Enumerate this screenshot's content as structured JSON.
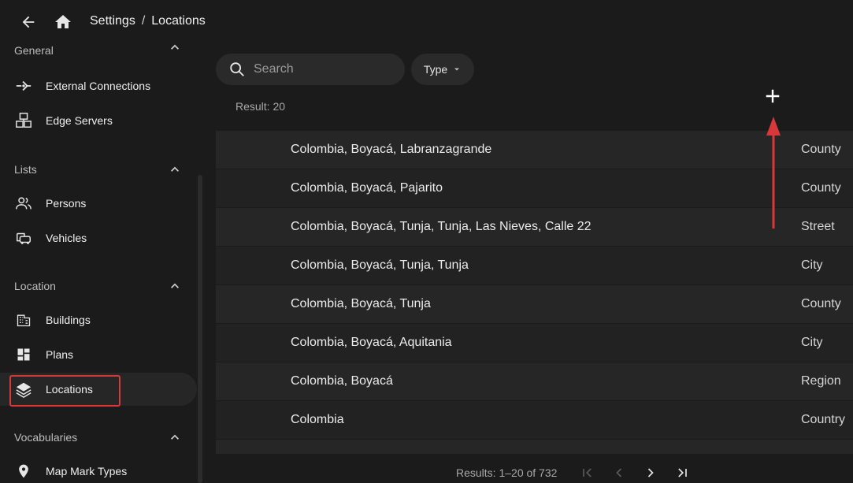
{
  "topbar": {
    "back_icon": "arrow-left-icon",
    "home_icon": "home-icon",
    "breadcrumb": [
      "Settings",
      "Locations"
    ],
    "separator": "/"
  },
  "sidebar": {
    "partial_header": "General",
    "items_top": [
      {
        "label": "External Connections",
        "icon": "connection-icon"
      },
      {
        "label": "Edge Servers",
        "icon": "servers-icon"
      }
    ],
    "sections": [
      {
        "title": "Lists",
        "items": [
          {
            "label": "Persons",
            "icon": "persons-icon"
          },
          {
            "label": "Vehicles",
            "icon": "vehicles-icon"
          }
        ]
      },
      {
        "title": "Location",
        "items": [
          {
            "label": "Buildings",
            "icon": "building-icon"
          },
          {
            "label": "Plans",
            "icon": "plans-icon"
          },
          {
            "label": "Locations",
            "icon": "layers-icon"
          }
        ]
      },
      {
        "title": "Vocabularies",
        "items": [
          {
            "label": "Map Mark Types",
            "icon": "map-marker-icon"
          }
        ]
      }
    ]
  },
  "main": {
    "search_placeholder": "Search",
    "type_filter": "Type",
    "result_label": "Result: 20",
    "rows": [
      {
        "name": "Colombia, Boyacá, Labranzagrande",
        "type": "County"
      },
      {
        "name": "Colombia, Boyacá, Pajarito",
        "type": "County"
      },
      {
        "name": "Colombia, Boyacá, Tunja, Tunja, Las Nieves, Calle 22",
        "type": "Street"
      },
      {
        "name": "Colombia, Boyacá, Tunja, Tunja",
        "type": "City"
      },
      {
        "name": "Colombia, Boyacá, Tunja",
        "type": "County"
      },
      {
        "name": "Colombia, Boyacá, Aquitania",
        "type": "City"
      },
      {
        "name": "Colombia, Boyacá",
        "type": "Region"
      },
      {
        "name": "Colombia",
        "type": "Country"
      },
      {
        "name": "",
        "type": ""
      }
    ],
    "pagination": {
      "label": "Results: 1–20 of 732"
    }
  },
  "colors": {
    "background": "#1b1b1b",
    "highlight_outline": "#d9383a",
    "annotation_arrow": "#d9383a"
  }
}
